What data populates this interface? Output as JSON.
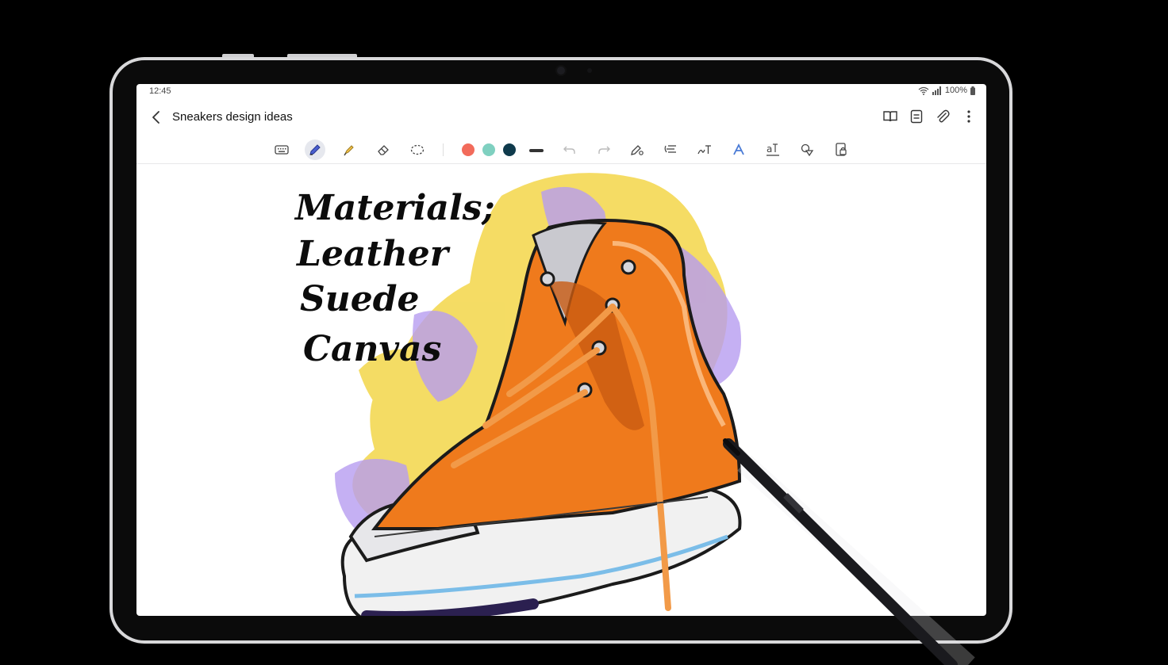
{
  "status_bar": {
    "time": "12:45",
    "battery": "100%"
  },
  "note": {
    "title": "Sneakers design ideas"
  },
  "icons": {
    "back": "chevron-left-icon",
    "appbar": [
      "book-view-icon",
      "page-view-icon",
      "attach-icon",
      "more-options-icon"
    ],
    "toolbar": [
      "keyboard-icon",
      "pen-icon",
      "highlighter-icon",
      "eraser-icon",
      "lasso-icon",
      "undo-icon",
      "redo-icon",
      "pen-settings-icon",
      "text-format-icon",
      "handwriting-to-text-icon",
      "text-style-icon",
      "text-size-icon",
      "shapes-icon",
      "lock-icon"
    ]
  },
  "toolbar": {
    "active_tool": "pen",
    "colors": [
      "#f26b5b",
      "#7fd0c0",
      "#0f3a4c"
    ]
  },
  "canvas": {
    "handwriting": [
      "Materials;",
      "Leather",
      "Suede",
      "Canvas"
    ]
  },
  "colors": {
    "accent_yellow": "#f3d649",
    "accent_purple": "#b79cf0",
    "shoe_orange": "#ef7a1c",
    "pen_body": "#1a1a1e"
  }
}
